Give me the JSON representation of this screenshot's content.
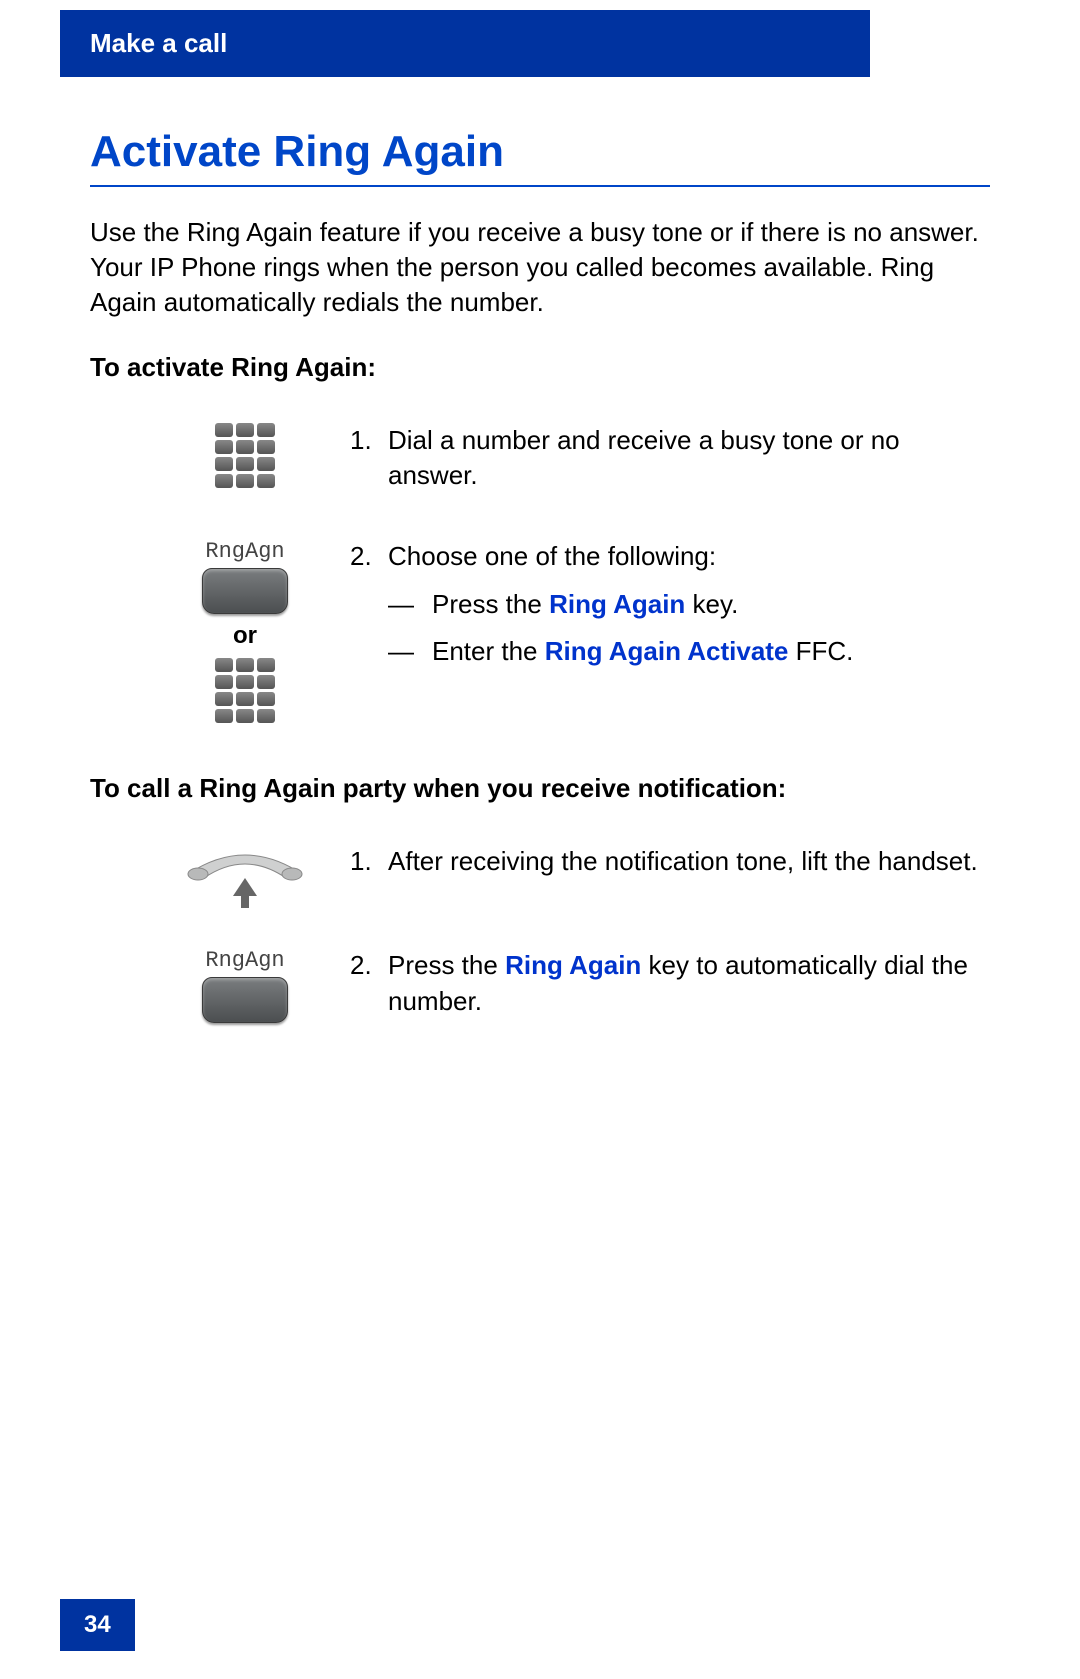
{
  "header": {
    "title": "Make a call"
  },
  "page": {
    "title": "Activate Ring Again",
    "intro": "Use the Ring Again feature if you receive a busy tone or if there is no answer. Your IP Phone rings when the person you called becomes available. Ring Again automatically redials the number.",
    "section1": {
      "heading": "To activate Ring Again:",
      "step1": {
        "num": "1.",
        "text": "Dial a number and receive a busy tone or no answer."
      },
      "step2": {
        "num": "2.",
        "lead": "Choose one of the following:",
        "bullets": [
          {
            "dash": "—",
            "pre": "Press the ",
            "key": "Ring Again",
            "post": " key."
          },
          {
            "dash": "—",
            "pre": "Enter the ",
            "key": "Ring Again Activate",
            "post": " FFC."
          }
        ]
      },
      "softkey_label": "RngAgn",
      "or_label": "or"
    },
    "section2": {
      "heading": "To call a Ring Again party when you receive notification:",
      "step1": {
        "num": "1.",
        "text": "After receiving the notification tone, lift the handset."
      },
      "step2": {
        "num": "2.",
        "pre": "Press the ",
        "key": "Ring Again",
        "post": " key to automatically dial the number."
      },
      "softkey_label": "RngAgn"
    },
    "page_number": "34"
  }
}
